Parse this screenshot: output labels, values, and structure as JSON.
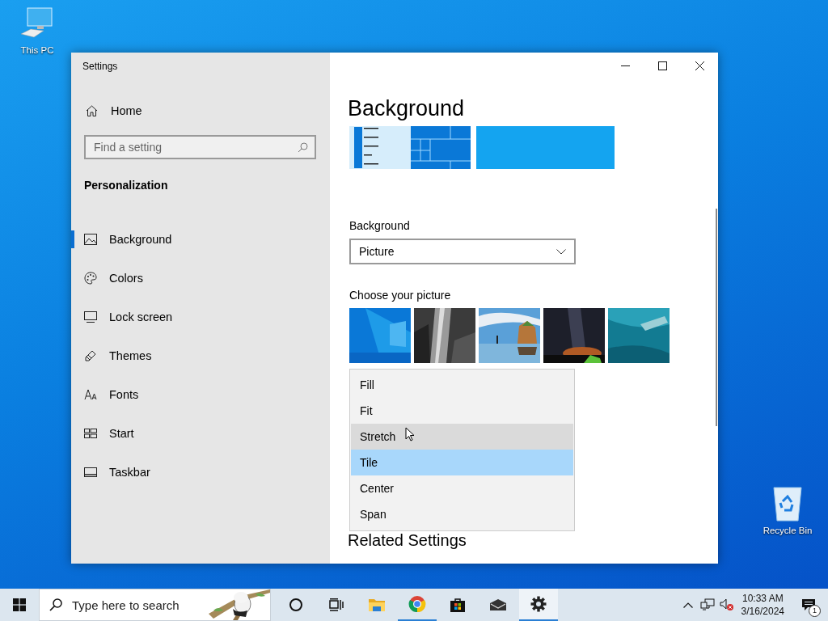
{
  "desktop_icons": [
    {
      "label": "This PC",
      "kind": "computer"
    },
    {
      "label": "Recycle Bin",
      "kind": "recycle"
    }
  ],
  "window": {
    "title": "Settings"
  },
  "sidebar": {
    "home": "Home",
    "search": {
      "placeholder": "Find a setting"
    },
    "section": "Personalization",
    "items": [
      {
        "label": "Background",
        "kind": "picture",
        "selected": true
      },
      {
        "label": "Colors",
        "kind": "palette",
        "selected": false
      },
      {
        "label": "Lock screen",
        "kind": "monitor",
        "selected": false
      },
      {
        "label": "Themes",
        "kind": "brush",
        "selected": false
      },
      {
        "label": "Fonts",
        "kind": "font",
        "selected": false
      },
      {
        "label": "Start",
        "kind": "start",
        "selected": false
      },
      {
        "label": "Taskbar",
        "kind": "taskbar",
        "selected": false
      }
    ]
  },
  "content": {
    "heading": "Background",
    "background_label": "Background",
    "background_dropdown": {
      "value": "Picture"
    },
    "choose_label": "Choose your picture",
    "fit_menu": [
      {
        "label": "Fill",
        "hovered": false,
        "selected": false
      },
      {
        "label": "Fit",
        "hovered": false,
        "selected": false
      },
      {
        "label": "Stretch",
        "hovered": true,
        "selected": false
      },
      {
        "label": "Tile",
        "hovered": false,
        "selected": true
      },
      {
        "label": "Center",
        "hovered": false,
        "selected": false
      },
      {
        "label": "Span",
        "hovered": false,
        "selected": false
      }
    ],
    "related_heading": "Related Settings"
  },
  "taskbar": {
    "search": {
      "placeholder": "Type here to search"
    },
    "apps": [
      {
        "kind": "cortana",
        "running": false,
        "selected": false
      },
      {
        "kind": "taskview",
        "running": false,
        "selected": false
      },
      {
        "kind": "folder",
        "running": false,
        "selected": false
      },
      {
        "kind": "browser",
        "running": true,
        "selected": false
      },
      {
        "kind": "store",
        "running": false,
        "selected": false
      },
      {
        "kind": "mail",
        "running": false,
        "selected": false
      },
      {
        "kind": "settings",
        "running": true,
        "selected": true
      }
    ],
    "time": "10:33 AM",
    "date": "3/16/2024",
    "notification_count": "1"
  }
}
